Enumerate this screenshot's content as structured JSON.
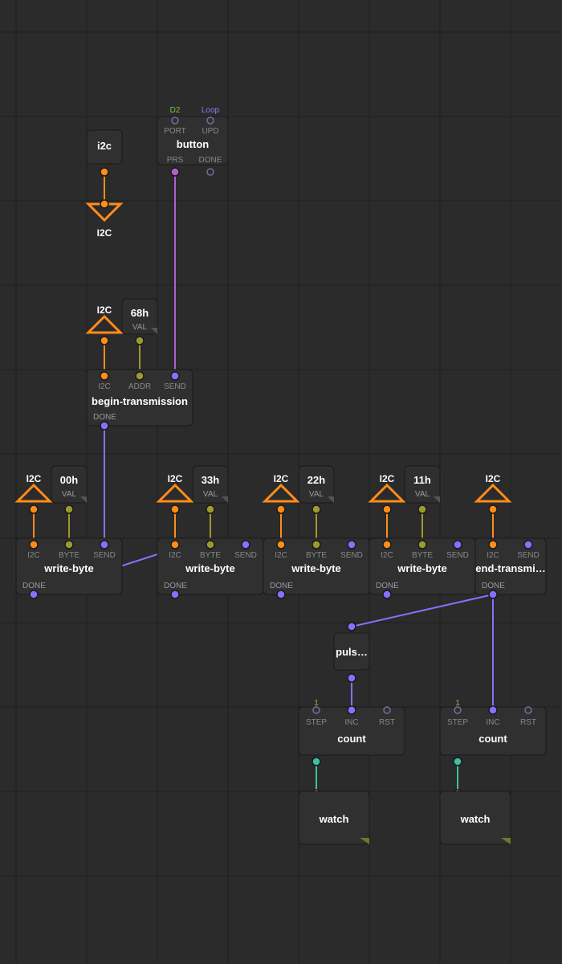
{
  "nodes": {
    "i2c": {
      "title": "i2c"
    },
    "i2c_down": {
      "label": "I2C"
    },
    "button": {
      "title": "button",
      "d2": "D2",
      "loop": "Loop",
      "port": "PORT",
      "upd": "UPD",
      "prs": "PRS",
      "done": "DONE"
    },
    "i2c_up_bt": {
      "label": "I2C"
    },
    "val_68": {
      "val": "68h",
      "lab": "VAL"
    },
    "begin": {
      "title": "begin-transmission",
      "i2c": "I2C",
      "addr": "ADDR",
      "send": "SEND",
      "done": "DONE"
    },
    "wb1": {
      "title": "write-byte",
      "tri": "I2C",
      "val": "00h",
      "vlab": "VAL",
      "i2c": "I2C",
      "byte": "BYTE",
      "send": "SEND",
      "done": "DONE"
    },
    "wb2": {
      "title": "write-byte",
      "tri": "I2C",
      "val": "33h",
      "vlab": "VAL",
      "i2c": "I2C",
      "byte": "BYTE",
      "send": "SEND",
      "done": "DONE"
    },
    "wb3": {
      "title": "write-byte",
      "tri": "I2C",
      "val": "22h",
      "vlab": "VAL",
      "i2c": "I2C",
      "byte": "BYTE",
      "send": "SEND",
      "done": "DONE"
    },
    "wb4": {
      "title": "write-byte",
      "tri": "I2C",
      "val": "11h",
      "vlab": "VAL",
      "i2c": "I2C",
      "byte": "BYTE",
      "send": "SEND",
      "done": "DONE"
    },
    "end": {
      "title": "end-transmi…",
      "tri": "I2C",
      "i2c": "I2C",
      "send": "SEND",
      "done": "DONE"
    },
    "pulse": {
      "title": "puls…"
    },
    "count1": {
      "title": "count",
      "step": "STEP",
      "inc": "INC",
      "rst": "RST",
      "one": "1"
    },
    "count2": {
      "title": "count",
      "step": "STEP",
      "inc": "INC",
      "rst": "RST",
      "one": "1"
    },
    "watch1": {
      "title": "watch"
    },
    "watch2": {
      "title": "watch"
    }
  }
}
